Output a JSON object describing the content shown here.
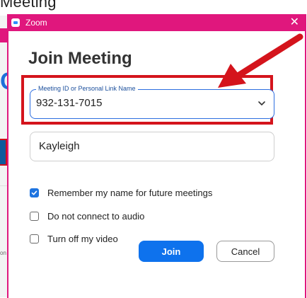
{
  "background": {
    "window_title": "Meeting",
    "small_text": "on"
  },
  "dialog": {
    "title": "Zoom",
    "close_glyph": "✕",
    "heading": "Join Meeting",
    "meeting_id": {
      "label": "Meeting ID or Personal Link Name",
      "value": "932-131-7015"
    },
    "name": {
      "value": "Kayleigh"
    },
    "options": [
      {
        "label": "Remember my name for future meetings",
        "checked": true
      },
      {
        "label": "Do not connect to audio",
        "checked": false
      },
      {
        "label": "Turn off my video",
        "checked": false
      }
    ],
    "buttons": {
      "join": "Join",
      "cancel": "Cancel"
    }
  },
  "colors": {
    "titlebar": "#e0177d",
    "callout": "#d4141c",
    "join": "#0e72ed",
    "checkbox_checked": "#1e74e0"
  },
  "icons": {
    "app": "zoom-app-icon",
    "close": "close-icon",
    "dropdown": "chevron-down-icon",
    "check": "checkmark-icon",
    "arrow": "red-arrow-annotation"
  }
}
